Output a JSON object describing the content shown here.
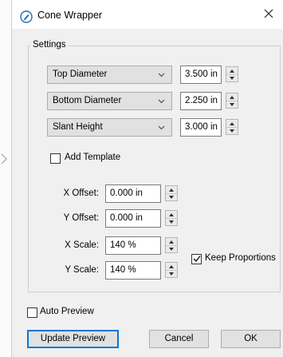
{
  "window": {
    "title": "Cone Wrapper",
    "close_label": "✕"
  },
  "settings": {
    "group_label": "Settings",
    "rows": [
      {
        "dropdown": "Top Diameter",
        "value": "3.500 in"
      },
      {
        "dropdown": "Bottom Diameter",
        "value": "2.250 in"
      },
      {
        "dropdown": "Slant Height",
        "value": "3.000 in"
      }
    ],
    "add_template": {
      "label": "Add Template",
      "checked": false
    },
    "x_offset": {
      "label": "X Offset:",
      "value": "0.000 in"
    },
    "y_offset": {
      "label": "Y Offset:",
      "value": "0.000 in"
    },
    "x_scale": {
      "label": "X Scale:",
      "value": "140 %"
    },
    "y_scale": {
      "label": "Y Scale:",
      "value": "140 %"
    },
    "keep_proportions": {
      "label": "Keep Proportions",
      "checked": true
    }
  },
  "auto_preview": {
    "label": "Auto Preview",
    "checked": false
  },
  "buttons": {
    "update_preview": "Update Preview",
    "cancel": "Cancel",
    "ok": "OK"
  },
  "colors": {
    "accent": "#0078d7",
    "dialog_bg": "#f0f0f0",
    "icon_blue": "#1f6fb5"
  },
  "icons": {
    "app": "pen-nib-icon",
    "dropdown": "chevron-down-icon",
    "spin": "spinner-arrows-icon"
  }
}
